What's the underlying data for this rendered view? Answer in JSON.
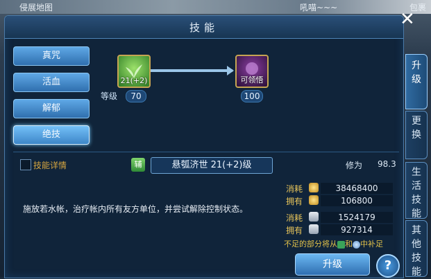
{
  "background": {
    "left_text": "侵展地图",
    "right_text": "吼喵~~~",
    "corner_text": "包裹"
  },
  "window": {
    "title": "技能"
  },
  "sidebar": {
    "items": [
      {
        "label": "真咒"
      },
      {
        "label": "活血"
      },
      {
        "label": "解郁"
      },
      {
        "label": "绝技",
        "active": true
      }
    ]
  },
  "skill_upgrade": {
    "current": {
      "label": "21(+2)",
      "level_label": "等级",
      "level_value": "70",
      "icon": "green-leaf-icon"
    },
    "next": {
      "label": "可领悟",
      "level_value": "100",
      "icon": "purple-skill-icon"
    }
  },
  "details": {
    "checkbox_label": "技能详情",
    "aux_tag": "辅",
    "skill_name": "悬瓠济世 21(+2)级",
    "cultivation_label": "修为",
    "cultivation_value": "98.3",
    "description": "施放若水帐，治疗帐内所有友方单位，并尝试解除控制状态。"
  },
  "resources": [
    {
      "consume_label": "消耗",
      "own_label": "拥有",
      "icon": "gold-coin-icon",
      "consume": "38468400",
      "own": "106800"
    },
    {
      "consume_label": "消耗",
      "own_label": "拥有",
      "icon": "scroll-icon",
      "consume": "1524179",
      "own": "927314"
    }
  ],
  "note": {
    "pre": "不足的部分将从",
    "mid": "和",
    "post": "中补足"
  },
  "buttons": {
    "upgrade": "升级",
    "help": "?",
    "close": "✕"
  },
  "tabs": [
    {
      "label": "升级",
      "active": true
    },
    {
      "label": "更换"
    },
    {
      "label": "生活技能"
    },
    {
      "label": "其他技能"
    }
  ],
  "colors": {
    "accent": "#3d86c8",
    "gold_text": "#e8c55a",
    "panel_bg": "#10243a"
  }
}
